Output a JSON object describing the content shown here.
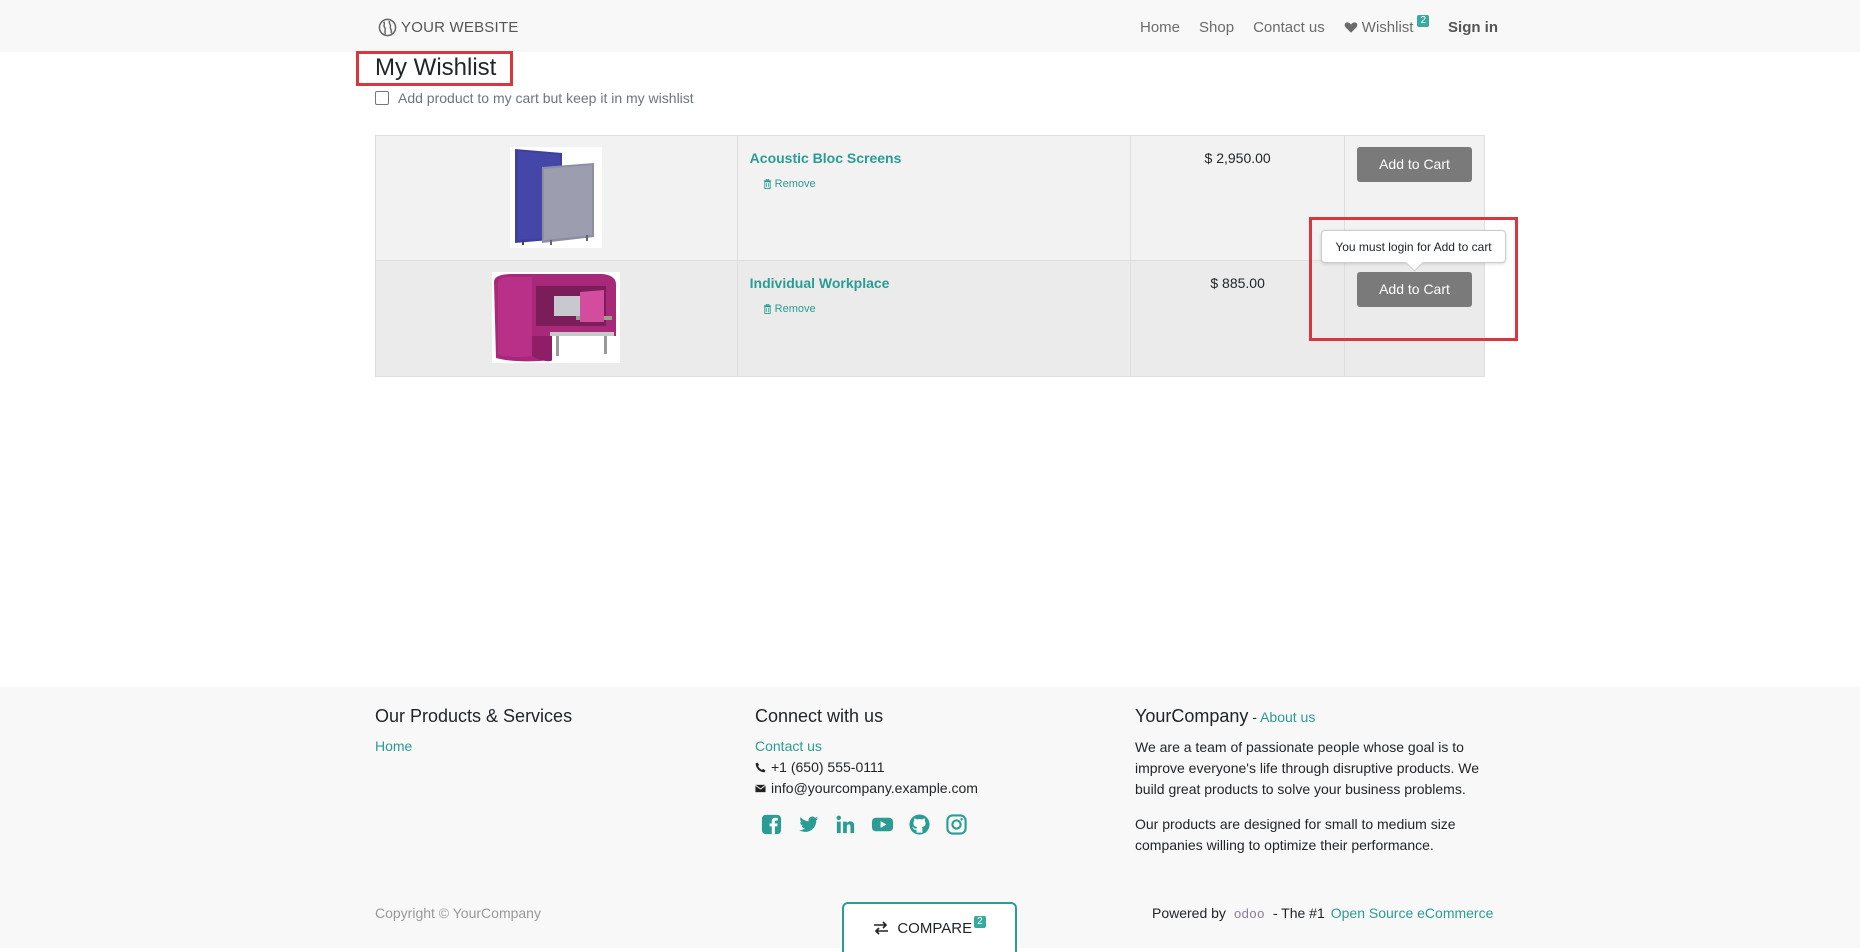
{
  "header": {
    "brand": "YOUR WEBSITE",
    "nav": {
      "home": "Home",
      "shop": "Shop",
      "contact": "Contact us",
      "wishlist": "Wishlist",
      "wishlist_count": "2",
      "signin": "Sign in"
    }
  },
  "page": {
    "title": "My Wishlist",
    "keep_in_wishlist_label": "Add product to my cart but keep it in my wishlist"
  },
  "wishlist": {
    "items": [
      {
        "name": "Acoustic Bloc Screens",
        "remove": "Remove",
        "price": "$ 2,950.00",
        "add_to_cart": "Add to Cart"
      },
      {
        "name": "Individual Workplace",
        "remove": "Remove",
        "price": "$ 885.00",
        "add_to_cart": "Add to Cart"
      }
    ]
  },
  "tooltip": {
    "text": "You must login for Add to cart"
  },
  "footer": {
    "products_heading": "Our Products & Services",
    "products_home": "Home",
    "connect_heading": "Connect with us",
    "contact_link": "Contact us",
    "phone": "+1 (650) 555-0111",
    "email": "info@yourcompany.example.com",
    "company_name": "YourCompany",
    "company_sep": " - ",
    "about_link": "About us",
    "about_p1": "We are a team of passionate people whose goal is to improve everyone's life through disruptive products. We build great products to solve your business problems.",
    "about_p2": "Our products are designed for small to medium size companies willing to optimize their performance.",
    "copyright": "Copyright © YourCompany",
    "compare_label": "COMPARE",
    "compare_count": "2",
    "powered_by": "Powered by",
    "odoo": "odoo",
    "powered_suffix": "- The #1",
    "ecommerce_link": "Open Source eCommerce"
  },
  "colors": {
    "accent": "#2b9c94",
    "highlight": "#d9363e",
    "button": "#7a7a7a"
  }
}
